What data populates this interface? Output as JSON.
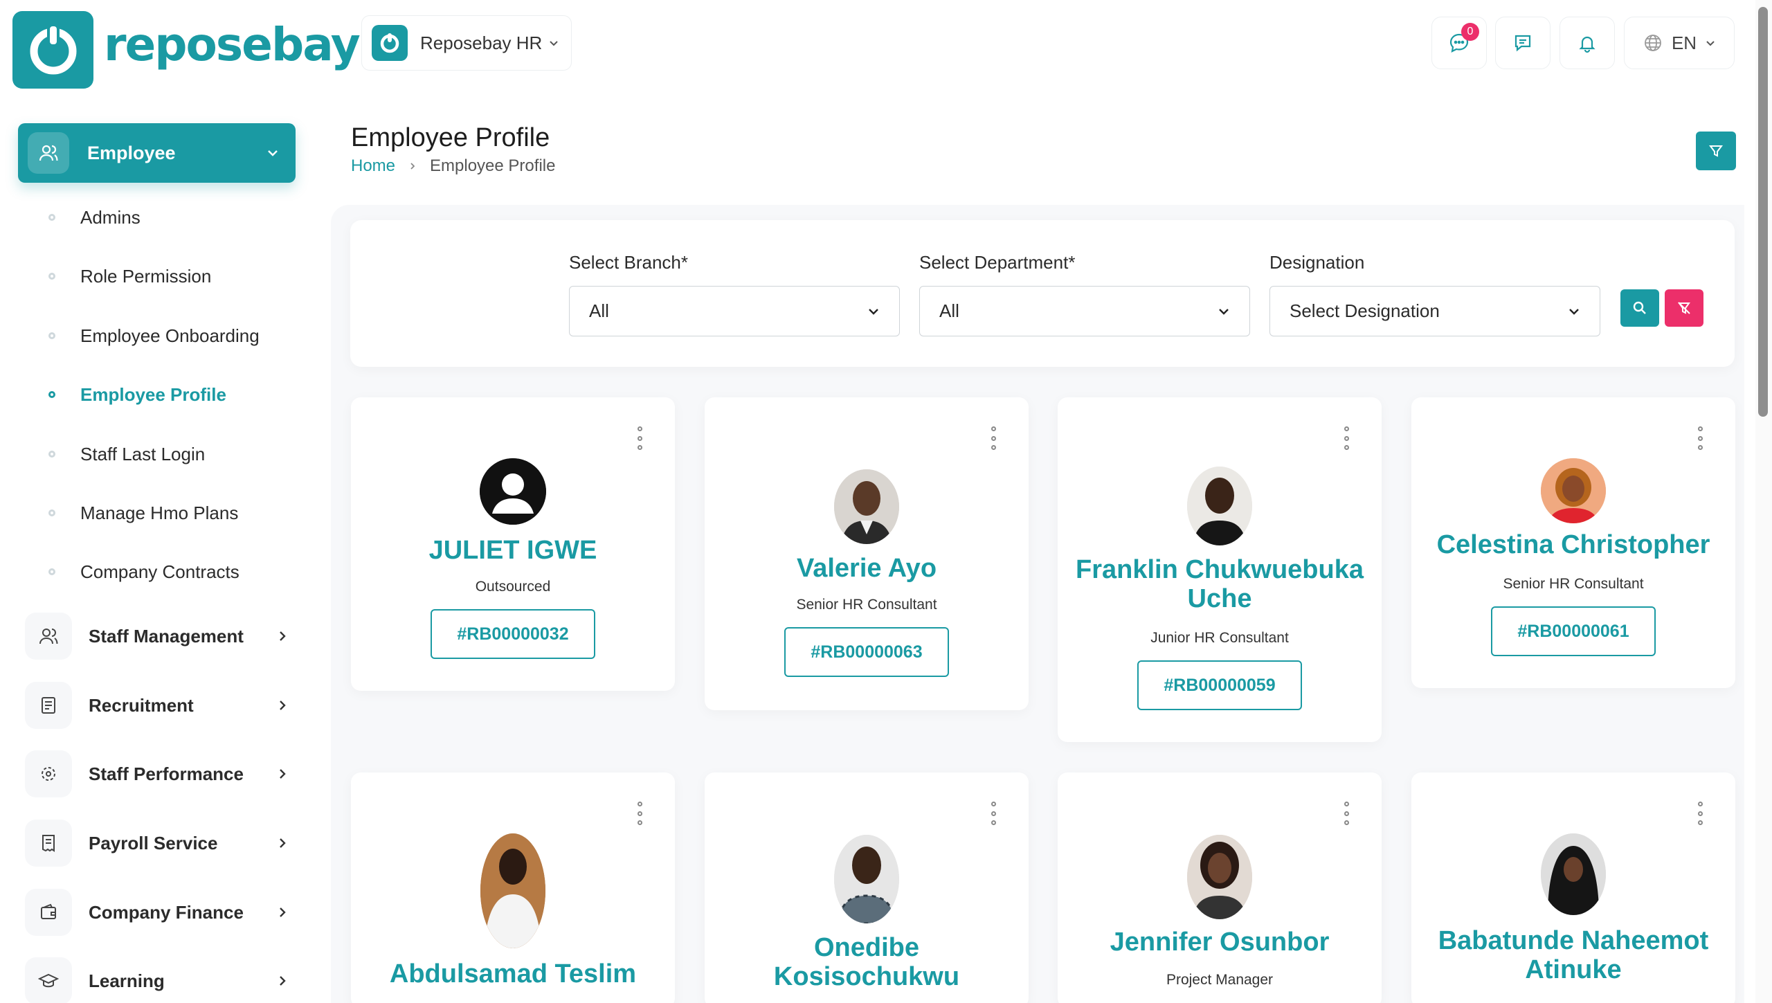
{
  "brand": {
    "name": "reposebay",
    "color": "#1a9aa3"
  },
  "company_select": {
    "label": "Reposebay HR"
  },
  "topbar": {
    "chat_badge": "0",
    "language": "EN"
  },
  "sidebar": {
    "active": {
      "label": "Employee"
    },
    "sub_items": [
      {
        "label": "Admins"
      },
      {
        "label": "Role Permission"
      },
      {
        "label": "Employee Onboarding"
      },
      {
        "label": "Employee Profile"
      },
      {
        "label": "Staff Last Login"
      },
      {
        "label": "Manage Hmo Plans"
      },
      {
        "label": "Company Contracts"
      }
    ],
    "items": [
      {
        "label": "Staff Management",
        "icon": "users-icon"
      },
      {
        "label": "Recruitment",
        "icon": "document-icon"
      },
      {
        "label": "Staff Performance",
        "icon": "target-icon"
      },
      {
        "label": "Payroll Service",
        "icon": "receipt-icon"
      },
      {
        "label": "Company Finance",
        "icon": "wallet-icon"
      },
      {
        "label": "Learning",
        "icon": "graduation-cap-icon"
      }
    ]
  },
  "page": {
    "title": "Employee Profile",
    "breadcrumb": {
      "home": "Home",
      "current": "Employee Profile"
    }
  },
  "filters": {
    "branch": {
      "label": "Select Branch*",
      "value": "All"
    },
    "department": {
      "label": "Select Department*",
      "value": "All"
    },
    "designation": {
      "label": "Designation",
      "value": "Select Designation"
    }
  },
  "employees": [
    {
      "name": "JULIET IGWE",
      "role": "Outsourced",
      "id": "#RB00000032"
    },
    {
      "name": "Valerie Ayo",
      "role": "Senior HR Consultant",
      "id": "#RB00000063"
    },
    {
      "name": "Franklin Chukwuebuka Uche",
      "role": "Junior HR Consultant",
      "id": "#RB00000059"
    },
    {
      "name": "Celestina Christopher",
      "role": "Senior HR Consultant",
      "id": "#RB00000061"
    },
    {
      "name": "Abdulsamad Teslim",
      "role": "",
      "id": ""
    },
    {
      "name": "Onedibe Kosisochukwu",
      "role": "",
      "id": ""
    },
    {
      "name": "Jennifer Osunbor",
      "role": "Project Manager",
      "id": ""
    },
    {
      "name": "Babatunde Naheemot Atinuke",
      "role": "",
      "id": ""
    }
  ]
}
